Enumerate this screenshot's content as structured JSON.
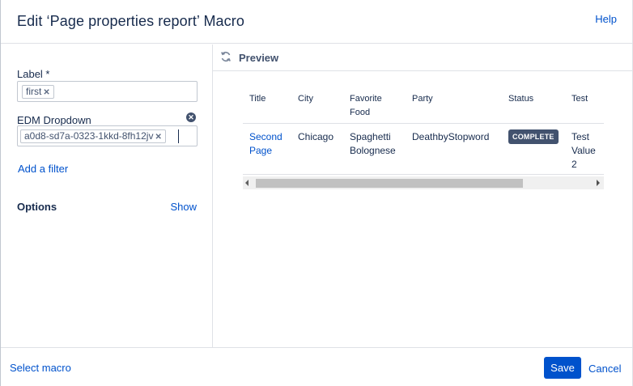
{
  "header": {
    "title": "Edit ‘Page properties report’ Macro",
    "help_label": "Help"
  },
  "left_panel": {
    "label_field": {
      "label": "Label *",
      "tags": [
        "first"
      ]
    },
    "edm_field": {
      "label": "EDM Dropdown",
      "tags": [
        "a0d8-sd7a-0323-1kkd-8fh12jv"
      ]
    },
    "add_filter_label": "Add a filter",
    "options_label": "Options",
    "show_label": "Show"
  },
  "preview": {
    "title": "Preview",
    "columns": [
      "Title",
      "City",
      "Favorite Food",
      "Party",
      "Status",
      "Test"
    ],
    "row": {
      "title_line1": "Second",
      "title_line2": "Page",
      "city": "Chicago",
      "food_line1": "Spaghetti",
      "food_line2": "Bolognese",
      "party": "DeathbyStopword",
      "status": "COMPLETE",
      "test_line1": "Test",
      "test_line2": "Value",
      "test_line3": "2"
    },
    "header_food_line1": "Favorite",
    "header_food_line2": "Food"
  },
  "footer": {
    "select_macro_label": "Select macro",
    "save_label": "Save",
    "cancel_label": "Cancel"
  },
  "colors": {
    "accent": "#0052cc",
    "lozenge": "#42526e",
    "text": "#172b4d"
  }
}
